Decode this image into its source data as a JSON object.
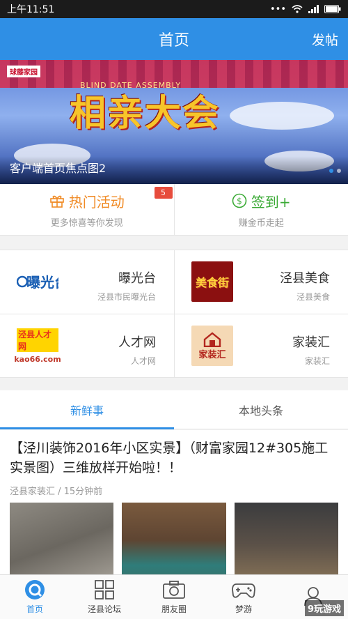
{
  "status": {
    "time": "上午11:51"
  },
  "header": {
    "title": "首页",
    "post_label": "发帖"
  },
  "banner": {
    "caption": "客户端首页焦点图2",
    "logo": "球藤家园",
    "subtitle": "BLIND DATE ASSEMBLY",
    "big_text": [
      "相",
      "亲",
      "大",
      "会"
    ]
  },
  "quick": [
    {
      "title": "热门活动",
      "subtitle": "更多惊喜等你发现",
      "badge": "5",
      "color": "#f08a24"
    },
    {
      "title": "签到+",
      "subtitle": "赚金币走起",
      "color": "#3aaa35"
    }
  ],
  "grid": [
    {
      "title": "曝光台",
      "subtitle": "泾县市民曝光台",
      "logo_text": "曝光台"
    },
    {
      "title": "泾县美食",
      "subtitle": "泾县美食",
      "logo_text": "美食街"
    },
    {
      "title": "人才网",
      "subtitle": "人才网",
      "logo_text": "泾县人才网",
      "logo_sub": "kao66.com"
    },
    {
      "title": "家装汇",
      "subtitle": "家装汇",
      "logo_text": "家装汇"
    }
  ],
  "tabs": [
    {
      "label": "新鲜事",
      "active": true
    },
    {
      "label": "本地头条",
      "active": false
    }
  ],
  "post": {
    "title": "【泾川装饰2016年小区实景】（财富家园12#305施工实景图）三维放样开始啦！！",
    "meta": "泾县家装汇 / 15分钟前"
  },
  "nav": [
    {
      "label": "首页",
      "icon": "home-icon",
      "active": true
    },
    {
      "label": "泾县论坛",
      "icon": "grid-icon",
      "active": false
    },
    {
      "label": "朋友圈",
      "icon": "camera-icon",
      "active": false
    },
    {
      "label": "梦游",
      "icon": "gamepad-icon",
      "active": false
    },
    {
      "label": "",
      "icon": "user-icon",
      "active": false
    }
  ],
  "watermark": "9玩游戏"
}
